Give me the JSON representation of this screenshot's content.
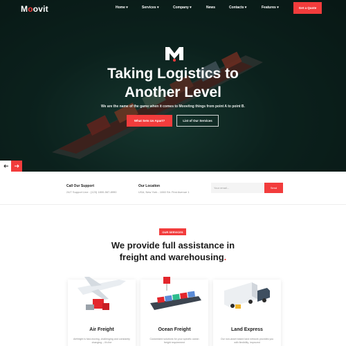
{
  "brand": {
    "name": "Moovit",
    "accent": "#f23c3c"
  },
  "nav": {
    "items": [
      "Home",
      "Services",
      "Company",
      "News",
      "Contacts",
      "Features"
    ],
    "quote_label": "Get a Quote"
  },
  "hero": {
    "title_line1": "Taking Logistics to",
    "title_line2": "Another Level",
    "subtitle": "We are the name of the game when it comes to Moovitng things from point A to point B.",
    "cta_primary": "What Sets Us Apart?",
    "cta_secondary": "List of Our Services"
  },
  "contact": {
    "support_title": "Call Our Support",
    "support_text": "24/7 Support Line : (123) 1800-567-8990",
    "location_title": "Our Location",
    "location_text": "USA, New York - 1060 Str. First Avenue 1",
    "email_placeholder": "Your email...",
    "send_label": "Send"
  },
  "services": {
    "badge": "OUR SERVICES",
    "title_line1": "We provide full assistance in",
    "title_line2": "freight and warehousing",
    "cards": [
      {
        "title": "Air Freight",
        "desc": "Airfreight is fast-moving, challenging and constantly changing – it's the"
      },
      {
        "title": "Ocean Freight",
        "desc": "Customized solutions for your specific ocean freight requirement"
      },
      {
        "title": "Land Express",
        "desc": "Our non-asset based land network provides you with flexibility, improved"
      }
    ]
  },
  "icons": [
    "chevron-down-icon",
    "arrow-left-icon",
    "arrow-right-icon",
    "m-logo-icon"
  ]
}
